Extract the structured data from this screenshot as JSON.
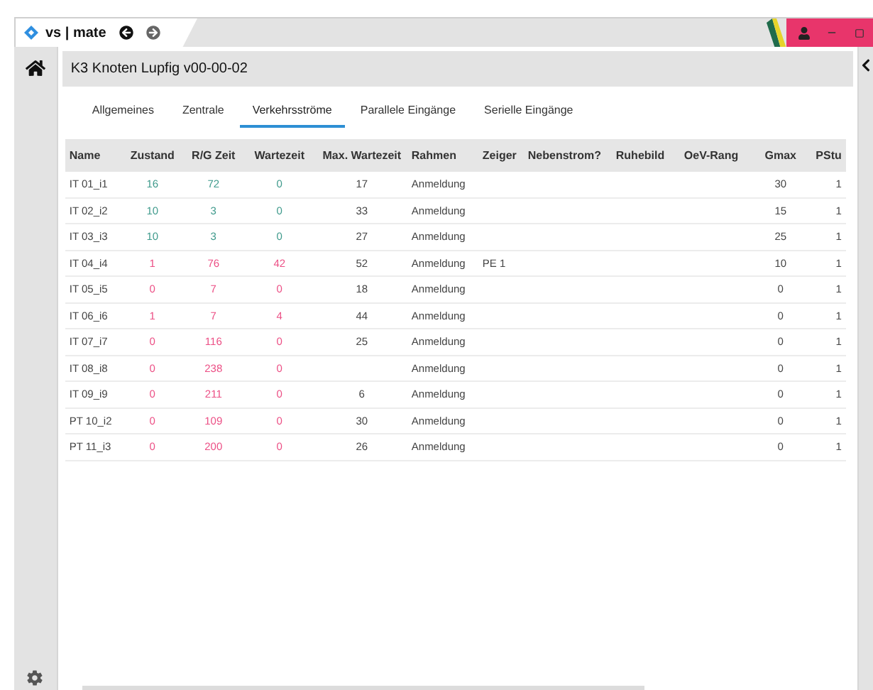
{
  "app_tab": {
    "title": "vs | mate"
  },
  "header": {
    "title": "K3 Knoten Lupfig v00-00-02"
  },
  "tabs": [
    {
      "label": "Allgemeines",
      "selected": false
    },
    {
      "label": "Zentrale",
      "selected": false
    },
    {
      "label": "Verkehrsströme",
      "selected": true
    },
    {
      "label": "Parallele Eingänge",
      "selected": false
    },
    {
      "label": "Serielle Eingänge",
      "selected": false
    }
  ],
  "table": {
    "columns": [
      "Name",
      "Zustand",
      "R/G Zeit",
      "Wartezeit",
      "Max. Wartezeit",
      "Rahmen",
      "Zeiger",
      "Nebenstrom?",
      "Ruhebild",
      "OeV-Rang",
      "Gmax",
      "PStu"
    ],
    "rows": [
      {
        "color": "#3f9a8c",
        "cells": [
          "IT 01_i1",
          "16",
          "72",
          "0",
          "17",
          "Anmeldung",
          "",
          "",
          "",
          "",
          "30",
          "1"
        ]
      },
      {
        "color": "#3f9a8c",
        "cells": [
          "IT 02_i2",
          "10",
          "3",
          "0",
          "33",
          "Anmeldung",
          "",
          "",
          "",
          "",
          "15",
          "1"
        ]
      },
      {
        "color": "#3f9a8c",
        "cells": [
          "IT 03_i3",
          "10",
          "3",
          "0",
          "27",
          "Anmeldung",
          "",
          "",
          "",
          "",
          "25",
          "1"
        ]
      },
      {
        "color": "#ec4f85",
        "cells": [
          "IT 04_i4",
          "1",
          "76",
          "42",
          "52",
          "Anmeldung",
          "PE 1",
          "",
          "",
          "",
          "10",
          "1"
        ]
      },
      {
        "color": "#ec4f85",
        "cells": [
          "IT 05_i5",
          "0",
          "7",
          "0",
          "18",
          "Anmeldung",
          "",
          "",
          "",
          "",
          "0",
          "1"
        ]
      },
      {
        "color": "#ec4f85",
        "cells": [
          "IT 06_i6",
          "1",
          "7",
          "4",
          "44",
          "Anmeldung",
          "",
          "",
          "",
          "",
          "0",
          "1"
        ]
      },
      {
        "color": "#ec4f85",
        "cells": [
          "IT 07_i7",
          "0",
          "116",
          "0",
          "25",
          "Anmeldung",
          "",
          "",
          "",
          "",
          "0",
          "1"
        ]
      },
      {
        "color": "#ec4f85",
        "cells": [
          "IT 08_i8",
          "0",
          "238",
          "0",
          "",
          "Anmeldung",
          "",
          "",
          "",
          "",
          "0",
          "1"
        ]
      },
      {
        "color": "#ec4f85",
        "cells": [
          "IT 09_i9",
          "0",
          "211",
          "0",
          "6",
          "Anmeldung",
          "",
          "",
          "",
          "",
          "0",
          "1"
        ]
      },
      {
        "color": "#ec4f85",
        "cells": [
          "PT 10_i2",
          "0",
          "109",
          "0",
          "30",
          "Anmeldung",
          "",
          "",
          "",
          "",
          "0",
          "1"
        ]
      },
      {
        "color": "#ec4f85",
        "cells": [
          "PT 11_i3",
          "0",
          "200",
          "0",
          "26",
          "Anmeldung",
          "",
          "",
          "",
          "",
          "0",
          "1"
        ]
      }
    ]
  }
}
